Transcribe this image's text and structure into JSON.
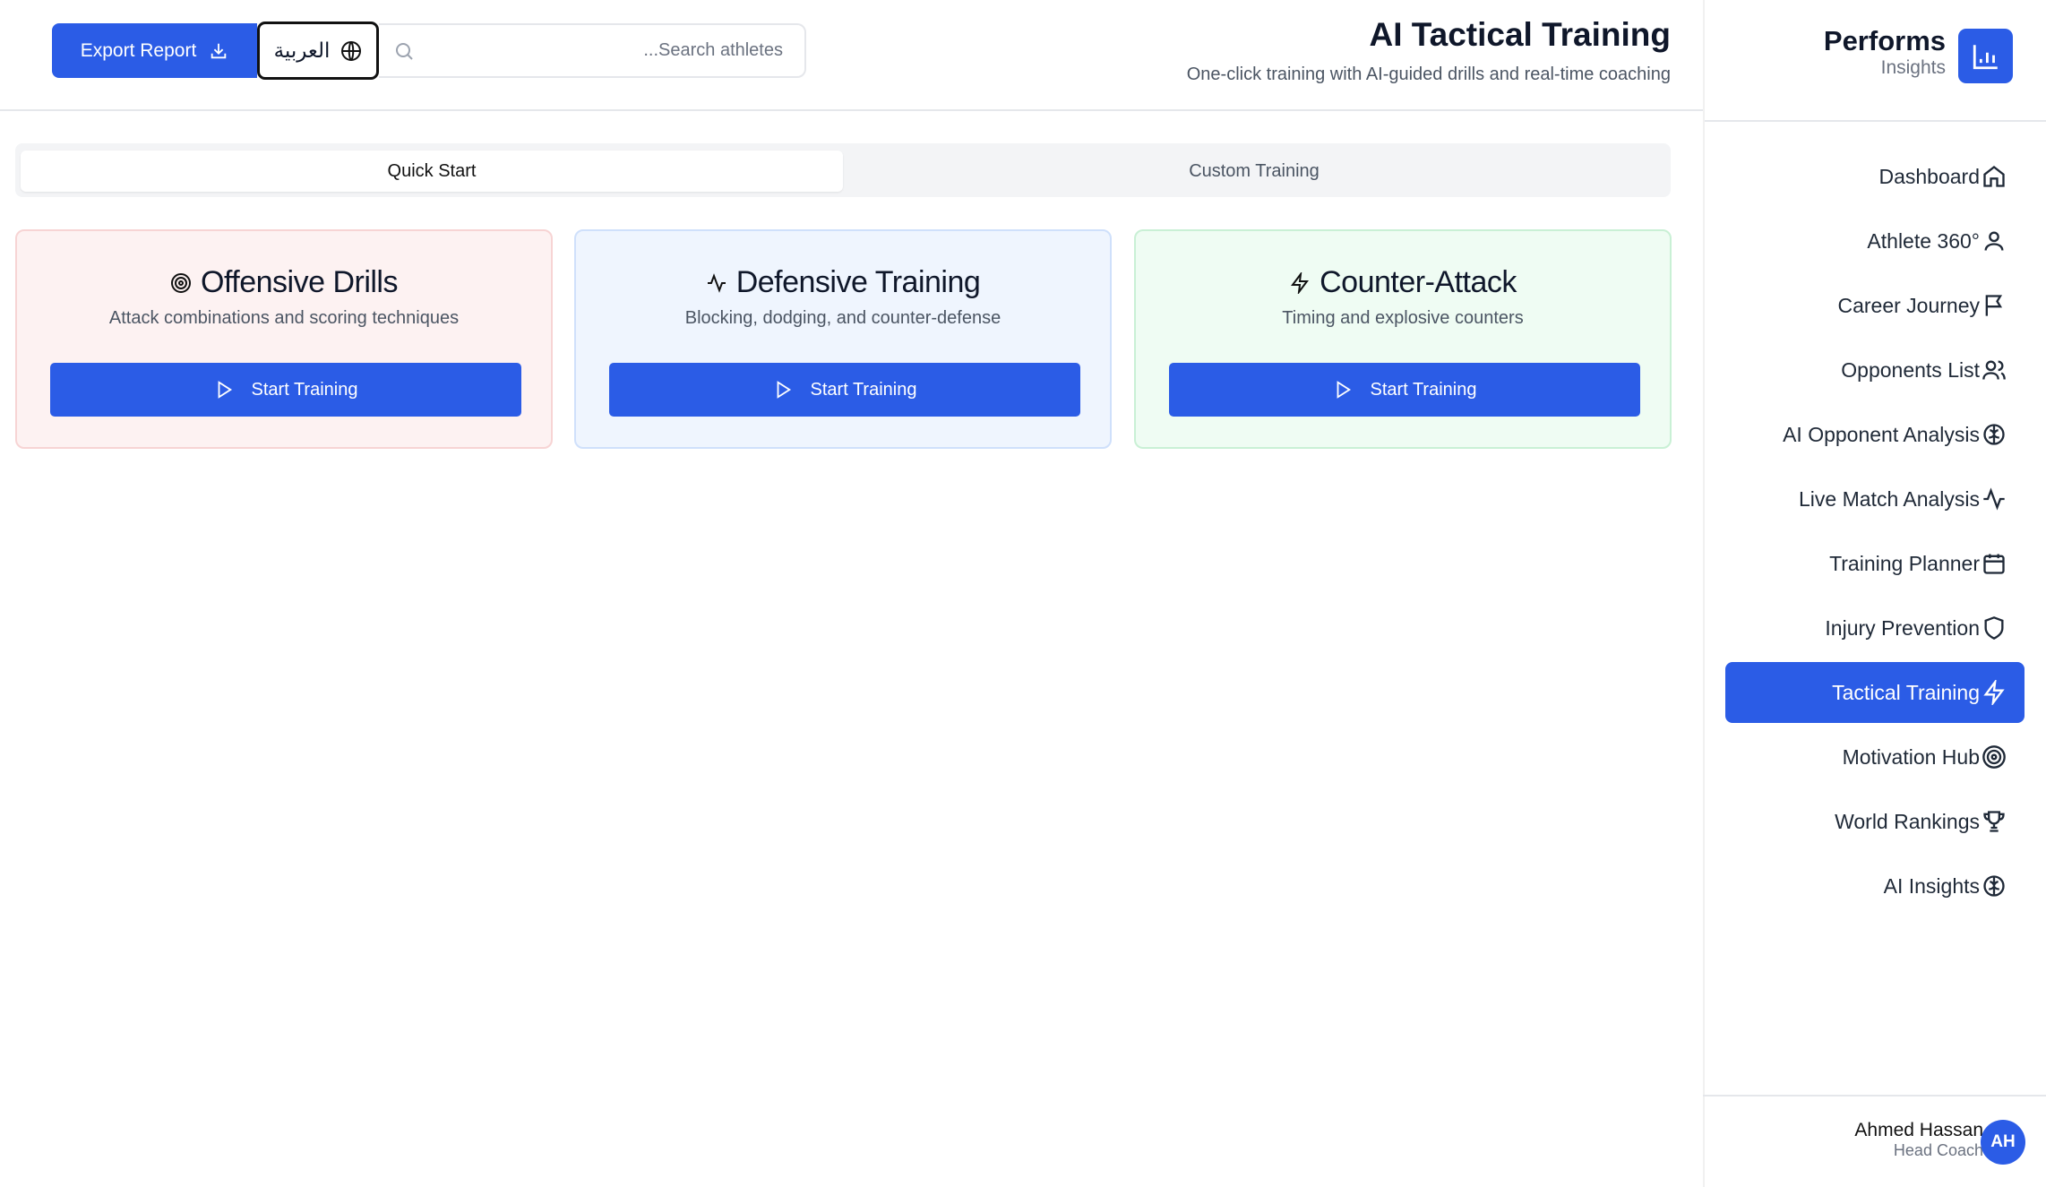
{
  "header": {
    "export_label": "Export Report",
    "language_label": "العربية",
    "search_placeholder": "...Search athletes",
    "title": "AI Tactical Training",
    "subtitle": "One-click training with AI-guided drills and real-time coaching"
  },
  "tabs": [
    {
      "label": "Quick Start",
      "active": true
    },
    {
      "label": "Custom Training",
      "active": false
    }
  ],
  "cards": [
    {
      "title": "Offensive Drills",
      "description": "Attack combinations and scoring techniques",
      "button": "Start Training",
      "icon": "target-icon"
    },
    {
      "title": "Defensive Training",
      "description": "Blocking, dodging, and counter-defense",
      "button": "Start Training",
      "icon": "activity-icon"
    },
    {
      "title": "Counter-Attack",
      "description": "Timing and explosive counters",
      "button": "Start Training",
      "icon": "zap-icon"
    }
  ],
  "brand": {
    "name": "Performs",
    "tagline": "Insights"
  },
  "nav": [
    {
      "label": "Dashboard",
      "icon": "home-icon"
    },
    {
      "label": "Athlete 360°",
      "icon": "user-icon"
    },
    {
      "label": "Career Journey",
      "icon": "flag-icon"
    },
    {
      "label": "Opponents List",
      "icon": "users-icon"
    },
    {
      "label": "AI Opponent Analysis",
      "icon": "brain-icon"
    },
    {
      "label": "Live Match Analysis",
      "icon": "activity-icon"
    },
    {
      "label": "Training Planner",
      "icon": "calendar-icon"
    },
    {
      "label": "Injury Prevention",
      "icon": "shield-icon"
    },
    {
      "label": "Tactical Training",
      "icon": "zap-icon",
      "active": true
    },
    {
      "label": "Motivation Hub",
      "icon": "target-icon"
    },
    {
      "label": "World Rankings",
      "icon": "trophy-icon"
    },
    {
      "label": "AI Insights",
      "icon": "brain-icon"
    }
  ],
  "user": {
    "name": "Ahmed Hassan",
    "role": "Head Coach",
    "initials": "AH"
  },
  "colors": {
    "accent": "#2b5ce6"
  }
}
